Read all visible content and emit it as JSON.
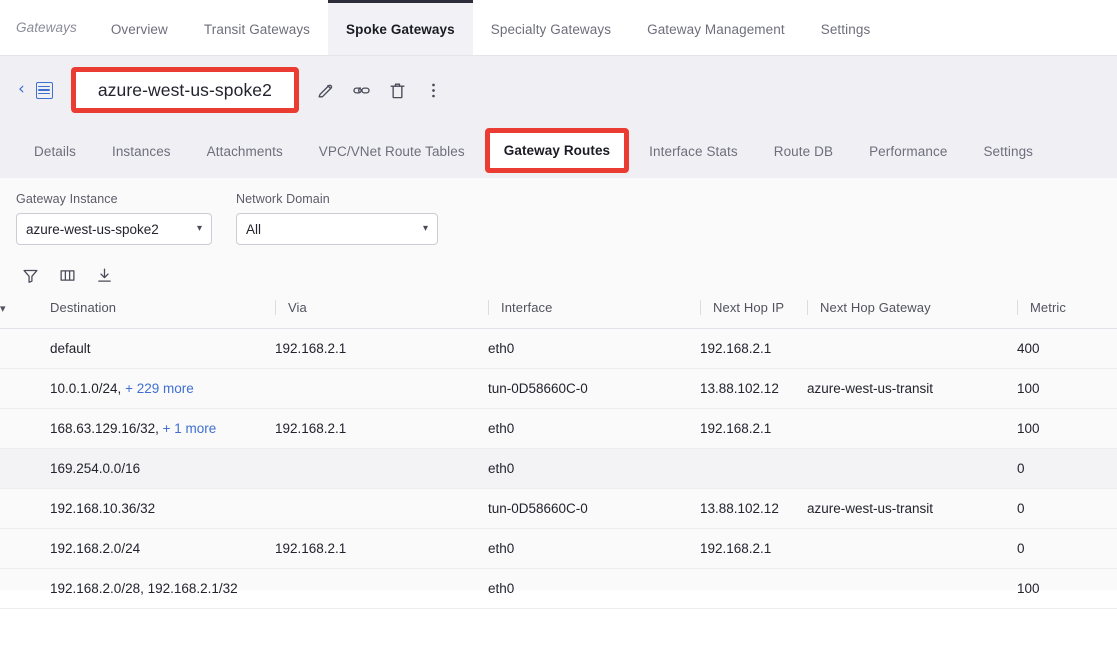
{
  "topnav": {
    "label": "Gateways",
    "tabs": [
      {
        "label": "Overview",
        "active": false
      },
      {
        "label": "Transit Gateways",
        "active": false
      },
      {
        "label": "Spoke Gateways",
        "active": true
      },
      {
        "label": "Specialty Gateways",
        "active": false
      },
      {
        "label": "Gateway Management",
        "active": false
      },
      {
        "label": "Settings",
        "active": false
      }
    ]
  },
  "header": {
    "back_icon": "chevron-left-icon",
    "grid_icon": "table-list-icon",
    "title": "azure-west-us-spoke2",
    "title_annotation_color": "#ea3c32",
    "actions": [
      {
        "name": "edit-button",
        "icon": "pencil-icon"
      },
      {
        "name": "link-button",
        "icon": "link-icon"
      },
      {
        "name": "delete-button",
        "icon": "trash-icon"
      },
      {
        "name": "more-actions-button",
        "icon": "kebab-menu-icon"
      }
    ]
  },
  "subtabs": [
    {
      "label": "Details",
      "active": false,
      "annotated": false
    },
    {
      "label": "Instances",
      "active": false,
      "annotated": false
    },
    {
      "label": "Attachments",
      "active": false,
      "annotated": false
    },
    {
      "label": "VPC/VNet Route Tables",
      "active": false,
      "annotated": false
    },
    {
      "label": "Gateway Routes",
      "active": true,
      "annotated": true
    },
    {
      "label": "Interface Stats",
      "active": false,
      "annotated": false
    },
    {
      "label": "Route DB",
      "active": false,
      "annotated": false
    },
    {
      "label": "Performance",
      "active": false,
      "annotated": false
    },
    {
      "label": "Settings",
      "active": false,
      "annotated": false
    }
  ],
  "filters": [
    {
      "label": "Gateway Instance",
      "value": "azure-west-us-spoke2"
    },
    {
      "label": "Network Domain",
      "value": "All"
    }
  ],
  "toolbar": [
    {
      "name": "filter-icon",
      "title": "Filter"
    },
    {
      "name": "columns-icon",
      "title": "Columns"
    },
    {
      "name": "download-icon",
      "title": "Download"
    }
  ],
  "table": {
    "sort_icon": "chevron-down-icon",
    "columns": [
      "Destination",
      "Via",
      "Interface",
      "Next Hop IP",
      "Next Hop Gateway",
      "Metric"
    ],
    "rows": [
      {
        "destination": "default",
        "destination_more": "",
        "via": "192.168.2.1",
        "interface": "eth0",
        "next_hop_ip": "192.168.2.1",
        "next_hop_gateway": "",
        "metric": "400",
        "highlighted": false
      },
      {
        "destination": "10.0.1.0/24,",
        "destination_more": "+ 229 more",
        "via": "",
        "interface": "tun-0D58660C-0",
        "next_hop_ip": "13.88.102.12",
        "next_hop_gateway": "azure-west-us-transit",
        "metric": "100",
        "highlighted": false
      },
      {
        "destination": "168.63.129.16/32,",
        "destination_more": "+ 1 more",
        "via": "192.168.2.1",
        "interface": "eth0",
        "next_hop_ip": "192.168.2.1",
        "next_hop_gateway": "",
        "metric": "100",
        "highlighted": false
      },
      {
        "destination": "169.254.0.0/16",
        "destination_more": "",
        "via": "",
        "interface": "eth0",
        "next_hop_ip": "",
        "next_hop_gateway": "",
        "metric": "0",
        "highlighted": true
      },
      {
        "destination": "192.168.10.36/32",
        "destination_more": "",
        "via": "",
        "interface": "tun-0D58660C-0",
        "next_hop_ip": "13.88.102.12",
        "next_hop_gateway": "azure-west-us-transit",
        "metric": "0",
        "highlighted": false
      },
      {
        "destination": "192.168.2.0/24",
        "destination_more": "",
        "via": "192.168.2.1",
        "interface": "eth0",
        "next_hop_ip": "192.168.2.1",
        "next_hop_gateway": "",
        "metric": "0",
        "highlighted": false
      },
      {
        "destination": "192.168.2.0/28, 192.168.2.1/32",
        "destination_more": "",
        "via": "",
        "interface": "eth0",
        "next_hop_ip": "",
        "next_hop_gateway": "",
        "metric": "100",
        "highlighted": false
      }
    ]
  }
}
